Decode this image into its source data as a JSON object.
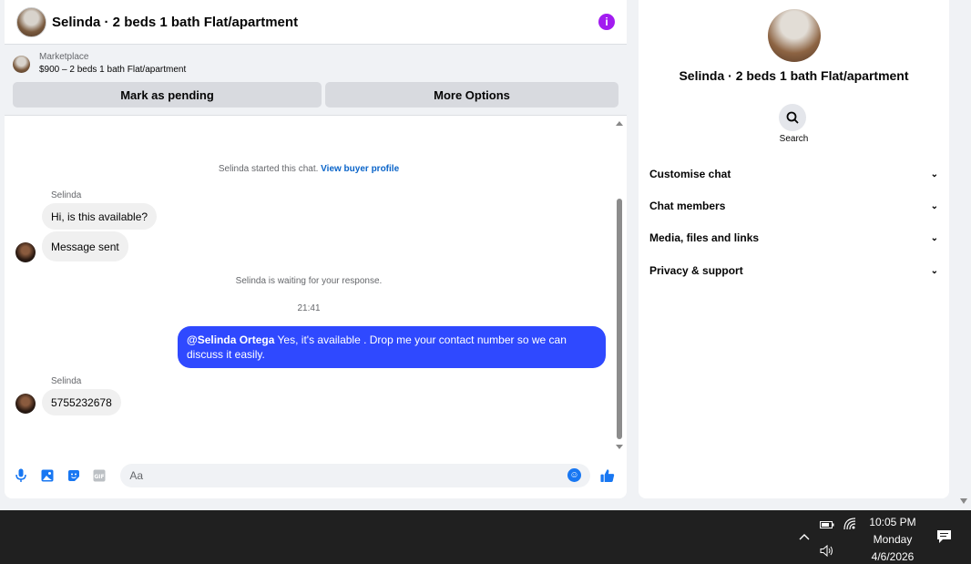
{
  "chat": {
    "title": "Selinda · 2 beds 1 bath Flat/apartment",
    "marketplace_label": "Marketplace",
    "listing_price": "$900 – 2 beds 1 bath Flat/apartment",
    "mark_pending_label": "Mark as pending",
    "more_options_label": "More Options",
    "started_text": "Selinda started this chat.",
    "view_buyer_profile": "View buyer profile",
    "sender_name_1": "Selinda",
    "msg_1": "Hi, is this available?",
    "msg_2": "Message sent",
    "waiting_text": "Selinda is waiting for your response.",
    "timestamp": "21:41",
    "out_mention": "@Selinda Ortega",
    "out_text": "Yes, it's available . Drop me your contact number so we can discuss it easily.",
    "sender_name_2": "Selinda",
    "msg_3": "5755232678",
    "composer_placeholder": "Aa"
  },
  "info_panel": {
    "title": "Selinda · 2 beds 1 bath Flat/apartment",
    "search_label": "Search",
    "rows": [
      {
        "label": "Customise chat"
      },
      {
        "label": "Chat members"
      },
      {
        "label": "Media, files and links"
      },
      {
        "label": "Privacy & support"
      }
    ]
  },
  "taskbar": {
    "time": "10:05 PM",
    "day": "Monday",
    "date": "4/6/2026"
  },
  "colors": {
    "accent": "#2f49ff",
    "link": "#0a64c9",
    "info_icon": "#a21cf0",
    "composer_icons": "#1877f2"
  }
}
